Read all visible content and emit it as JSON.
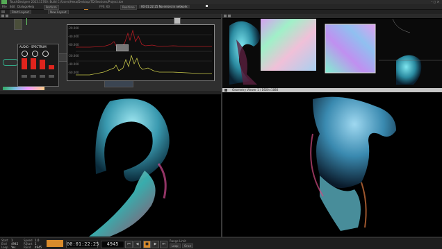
{
  "window": {
    "title": "TouchDesigner 2023.11760: Build  C:/Users/Hexa/Desktop/TD/Sessions/Project.toe",
    "controls": "–  ▢  ✕"
  },
  "menu": [
    "File",
    "Edit",
    "Dialogs",
    "Help"
  ],
  "toolbar": {
    "perform": "Perform",
    "fps": "FPS: 60",
    "realtime": "Realtime",
    "status": "00:01:22:25 No errors in network"
  },
  "tabs": {
    "left": "Start Layout",
    "right": "New Layout"
  },
  "right_bottom_title": "Geometry Viewer 1 / 1920×1080",
  "mixer": {
    "title": "AUDIO · SPECTRUM"
  },
  "graph": {
    "labels": [
      "-20.000",
      "-40.000",
      "-60.000",
      "-20.000",
      "-40.000",
      "-60.000"
    ]
  },
  "status": {
    "labels": [
      "Start",
      "End",
      "Loop",
      "Speed",
      "RStart",
      "REnd"
    ],
    "values": [
      "1",
      "4945",
      "Yes",
      "1.0",
      "1",
      "4945"
    ]
  },
  "transport": {
    "timecode": "00:01:22:25",
    "frame": "4945",
    "buttons": [
      "⏮",
      "◀",
      "■",
      "▶",
      "⏭"
    ],
    "range_label": "Range Limit",
    "range_opts": [
      "Loop",
      "Once"
    ]
  },
  "colors": {
    "accent": "#d98b2c",
    "mixer_red": "#e0241d",
    "spec_red": "#b41c24",
    "spec_yellow": "#c8c84a"
  }
}
